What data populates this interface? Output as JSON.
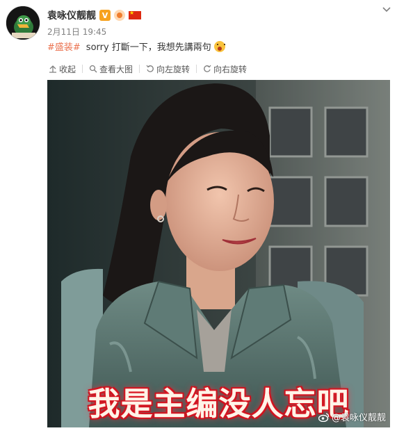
{
  "user": {
    "name": "袁咏仪靓靓",
    "verified_badge": "V"
  },
  "post": {
    "time": "2月11日 19:45",
    "hashtag": "#盛装#",
    "text": "sorry 打斷一下，我想先講兩句",
    "emoji": "surprised-face"
  },
  "toolbar": {
    "collapse_label": "收起",
    "view_large_label": "查看大图",
    "rotate_left_label": "向左旋转",
    "rotate_right_label": "向右旋转"
  },
  "image": {
    "caption": "我是主编没人忘吧",
    "watermark": "@袁咏仪靓靓"
  },
  "colors": {
    "hashtag": "#eb7350",
    "caption_glow": "#e0202a"
  }
}
